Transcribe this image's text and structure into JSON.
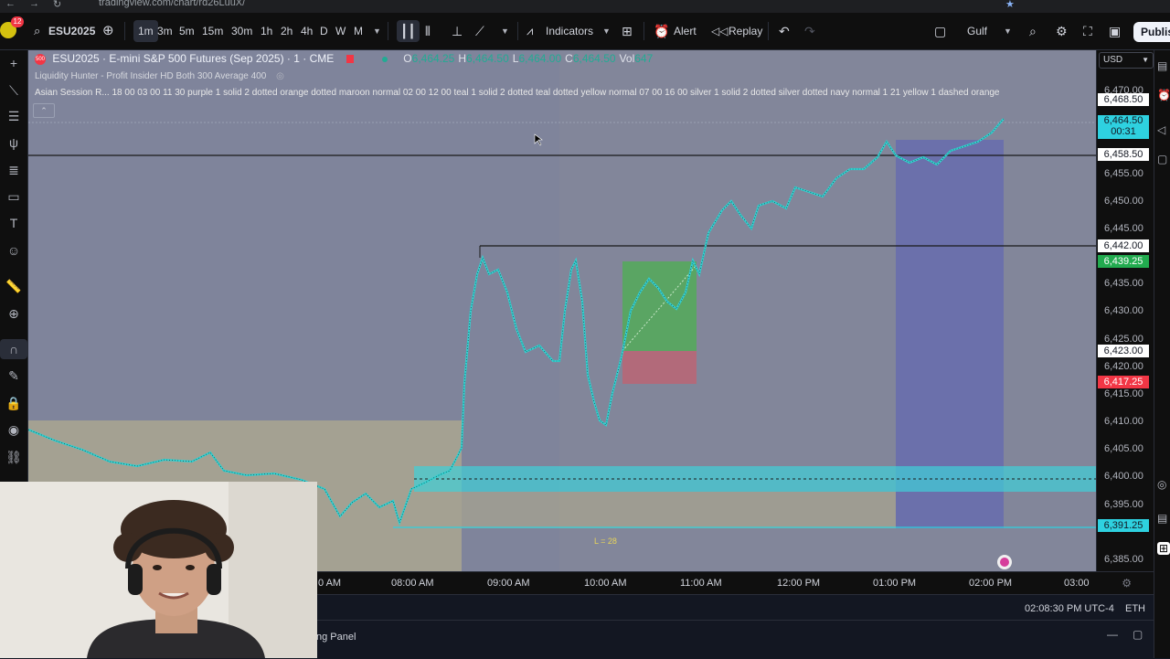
{
  "browser": {
    "url": "tradingview.com/chart/rd26LuuX/"
  },
  "toolbar": {
    "badge": "12",
    "symbol": "ESU2025",
    "timeframes": [
      "1m",
      "3m",
      "5m",
      "15m",
      "30m",
      "1h",
      "2h",
      "4h",
      "D",
      "W",
      "M"
    ],
    "active_timeframe": "1m",
    "indicators_label": "Indicators",
    "alert_label": "Alert",
    "replay_label": "Replay",
    "layout_name": "Gulf",
    "publish_label": "Publish"
  },
  "legend": {
    "symbol_badge": "500",
    "title": "ESU2025 · E-mini S&P 500 Futures (Sep 2025) · 1 · CME",
    "ohlc": [
      {
        "label": "O",
        "value": "6,464.25"
      },
      {
        "label": "H",
        "value": "6,464.50"
      },
      {
        "label": "L",
        "value": "6,464.00"
      },
      {
        "label": "C",
        "value": "6,464.50"
      },
      {
        "label": "Vol",
        "value": "647"
      }
    ],
    "indicator1": "Liquidity Hunter - Profit Insider HD Both 300 Average 400",
    "indicator2": "Asian Session R...  18 00 03 00 11 30 purple 1 solid 2 dotted orange dotted maroon normal 02 00 12 00 teal 1 solid 2 dotted teal dotted yellow normal 07 00 16 00 silver 1 solid 2 dotted silver dotted navy normal 1 21 yellow 1 dashed orange"
  },
  "price_axis": {
    "currency": "USD",
    "labels": [
      "6,470.00",
      "6,455.00",
      "6,450.00",
      "6,445.00",
      "6,435.00",
      "6,430.00",
      "6,425.00",
      "6,420.00",
      "6,415.00",
      "6,410.00",
      "6,405.00",
      "6,400.00",
      "6,395.00",
      "6,385.00"
    ],
    "badges": [
      {
        "value": "6,468.50",
        "bg": "#ffffff",
        "fg": "#131722"
      },
      {
        "value": "6,464.50",
        "sub": "00:31",
        "bg": "#2ed1e0",
        "fg": "#131722"
      },
      {
        "value": "6,458.50",
        "bg": "#ffffff",
        "fg": "#131722"
      },
      {
        "value": "6,442.00",
        "bg": "#ffffff",
        "fg": "#131722"
      },
      {
        "value": "6,439.25",
        "bg": "#22ab4f",
        "fg": "#ffffff"
      },
      {
        "value": "6,423.00",
        "bg": "#ffffff",
        "fg": "#131722"
      },
      {
        "value": "6,417.25",
        "bg": "#f23645",
        "fg": "#ffffff"
      },
      {
        "value": "6,391.25",
        "bg": "#2ed1e0",
        "fg": "#131722"
      }
    ]
  },
  "time_axis": {
    "labels": [
      "0 AM",
      "08:00 AM",
      "09:00 AM",
      "10:00 AM",
      "11:00 AM",
      "12:00 PM",
      "01:00 PM",
      "02:00 PM",
      "03:00"
    ]
  },
  "status": {
    "clock": "02:08:30 PM UTC-4",
    "session": "ETH"
  },
  "bottom_panel": {
    "label": "ng Panel"
  },
  "annotations": {
    "length_label": "L = 28"
  },
  "colors": {
    "chart_bg": "#7a7f96",
    "candle": "#34d0d0",
    "green_zone": "#4caf50",
    "red_zone": "#c2606f",
    "blue_zone": "#5b62b8",
    "teal_zone": "#3fd0d8"
  }
}
